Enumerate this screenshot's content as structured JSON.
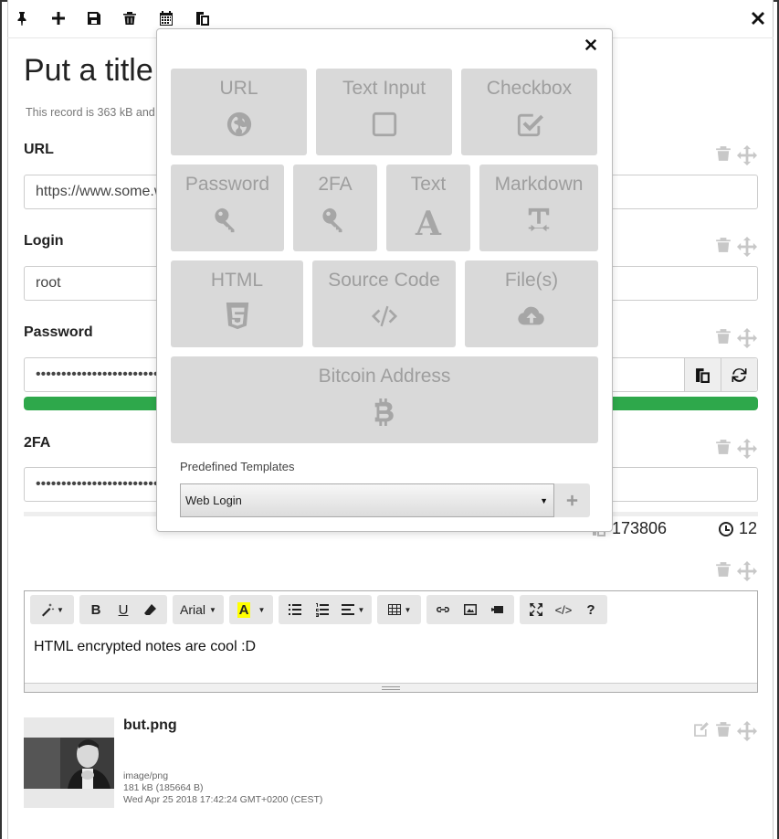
{
  "toolbar": {
    "icons": [
      "pin-icon",
      "plus-icon",
      "save-icon",
      "trash-icon",
      "calendar-icon",
      "copy-icon"
    ],
    "close_icon": "close-icon"
  },
  "record": {
    "title": "Put a title",
    "meta": "This record is 363 kB and"
  },
  "fields": {
    "url": {
      "label": "URL",
      "value": "https://www.some.w"
    },
    "login": {
      "label": "Login",
      "value": "root"
    },
    "password": {
      "label": "Password",
      "value": "••••••••••••••••••••••••",
      "strength": 1.0
    },
    "tfa": {
      "label": "2FA",
      "value": "••••••••••••••••••••••••",
      "code": "173806",
      "seconds": "12"
    }
  },
  "editor": {
    "font": "Arial",
    "content": "HTML encrypted notes are cool :D"
  },
  "file": {
    "name": "but.png",
    "mime": "image/png",
    "size": "181 kB (185664 B)",
    "date": "Wed Apr 25 2018 17:42:24 GMT+0200 (CEST)"
  },
  "modal": {
    "tiles": {
      "url": "URL",
      "text_input": "Text Input",
      "checkbox": "Checkbox",
      "password": "Password",
      "tfa": "2FA",
      "text": "Text",
      "markdown": "Markdown",
      "html": "HTML",
      "source_code": "Source Code",
      "files": "File(s)",
      "bitcoin": "Bitcoin Address"
    },
    "templates_label": "Predefined Templates",
    "templates_selected": "Web Login"
  },
  "colors": {
    "strength": "#2ea84b",
    "tile_bg": "#d9d9d9",
    "tile_text": "#9e9e9e"
  }
}
